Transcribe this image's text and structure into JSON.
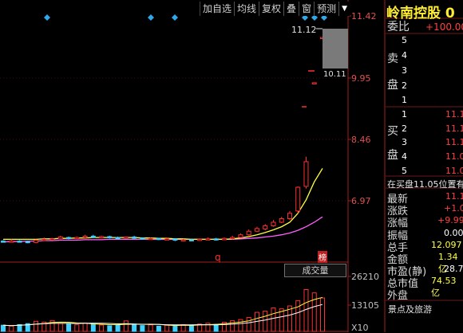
{
  "toolbar": {
    "buttons": [
      "加自选",
      "均线",
      "复权",
      "叠",
      "窗",
      "预测"
    ],
    "dropdown_icon": "caret-down-icon"
  },
  "stock": {
    "name": "岭南控股",
    "code_partial": "0"
  },
  "axis": {
    "price_ticks": [
      "11.42",
      "9.95",
      "8.46",
      "6.97"
    ],
    "volume_ticks": [
      "26210",
      "13105",
      "X10"
    ]
  },
  "annotations": {
    "high_label": "11.12",
    "low_label": "10.11",
    "marker_q": "q",
    "marker_bang": "榜"
  },
  "volume_indicator_label": "成交量",
  "sidebar": {
    "weibi_label": "委比",
    "weibi_value": "+100.00",
    "sell_label": "卖盘",
    "sell_levels": [
      "5",
      "4",
      "3",
      "2",
      "1"
    ],
    "buy_label": "买盘",
    "buy_levels": [
      "1",
      "2",
      "3",
      "4",
      "5"
    ],
    "buy_prices": [
      "11.1",
      "11.1",
      "11.1",
      "11.0",
      "11.0"
    ],
    "note": "在买盘11.05位置有",
    "quotes": [
      {
        "label": "最新",
        "value": "11.1"
      },
      {
        "label": "涨跌",
        "value": "+1.0"
      },
      {
        "label": "涨幅",
        "value": "+9.99"
      },
      {
        "label": "振幅",
        "value": "0.00"
      },
      {
        "label": "总手",
        "value": "12.097"
      },
      {
        "label": "金额",
        "value": "1.34亿"
      },
      {
        "label": "市盈(静)",
        "value": "28.7"
      },
      {
        "label": "总市值",
        "value": "74.53亿"
      },
      {
        "label": "外盘",
        "value": ""
      }
    ],
    "industry": "景点及旅游"
  },
  "colors": {
    "up": "#ff3030",
    "down": "#40d0ff",
    "ma_yellow": "#ffff40",
    "ma_pink": "#ff60ff",
    "axis_red": "#a02020",
    "title": "#ffee30"
  },
  "chart_data": {
    "type": "candlestick",
    "price_range": [
      6.2,
      11.6
    ],
    "candles": [
      {
        "o": 6.58,
        "c": 6.56,
        "h": 6.6,
        "l": 6.55
      },
      {
        "o": 6.56,
        "c": 6.58,
        "h": 6.62,
        "l": 6.55
      },
      {
        "o": 6.58,
        "c": 6.57,
        "h": 6.6,
        "l": 6.55
      },
      {
        "o": 6.57,
        "c": 6.55,
        "h": 6.58,
        "l": 6.53
      },
      {
        "o": 6.55,
        "c": 6.6,
        "h": 6.62,
        "l": 6.53
      },
      {
        "o": 6.6,
        "c": 6.62,
        "h": 6.66,
        "l": 6.58
      },
      {
        "o": 6.62,
        "c": 6.63,
        "h": 6.65,
        "l": 6.6
      },
      {
        "o": 6.63,
        "c": 6.67,
        "h": 6.7,
        "l": 6.62
      },
      {
        "o": 6.66,
        "c": 6.64,
        "h": 6.68,
        "l": 6.62
      },
      {
        "o": 6.64,
        "c": 6.66,
        "h": 6.68,
        "l": 6.62
      },
      {
        "o": 6.66,
        "c": 6.69,
        "h": 6.72,
        "l": 6.64
      },
      {
        "o": 6.69,
        "c": 6.67,
        "h": 6.72,
        "l": 6.65
      },
      {
        "o": 6.67,
        "c": 6.68,
        "h": 6.7,
        "l": 6.66
      },
      {
        "o": 6.68,
        "c": 6.66,
        "h": 6.7,
        "l": 6.64
      },
      {
        "o": 6.66,
        "c": 6.65,
        "h": 6.68,
        "l": 6.63
      },
      {
        "o": 6.65,
        "c": 6.67,
        "h": 6.68,
        "l": 6.63
      },
      {
        "o": 6.67,
        "c": 6.65,
        "h": 6.7,
        "l": 6.63
      },
      {
        "o": 6.65,
        "c": 6.63,
        "h": 6.66,
        "l": 6.61
      },
      {
        "o": 6.63,
        "c": 6.64,
        "h": 6.66,
        "l": 6.62
      },
      {
        "o": 6.64,
        "c": 6.62,
        "h": 6.65,
        "l": 6.6
      },
      {
        "o": 6.62,
        "c": 6.63,
        "h": 6.65,
        "l": 6.6
      },
      {
        "o": 6.63,
        "c": 6.6,
        "h": 6.64,
        "l": 6.58
      },
      {
        "o": 6.6,
        "c": 6.61,
        "h": 6.63,
        "l": 6.58
      },
      {
        "o": 6.61,
        "c": 6.6,
        "h": 6.63,
        "l": 6.58
      },
      {
        "o": 6.6,
        "c": 6.62,
        "h": 6.64,
        "l": 6.59
      },
      {
        "o": 6.62,
        "c": 6.63,
        "h": 6.66,
        "l": 6.6
      },
      {
        "o": 6.63,
        "c": 6.61,
        "h": 6.65,
        "l": 6.59
      },
      {
        "o": 6.61,
        "c": 6.64,
        "h": 6.66,
        "l": 6.6
      },
      {
        "o": 6.64,
        "c": 6.66,
        "h": 6.7,
        "l": 6.62
      },
      {
        "o": 6.66,
        "c": 6.72,
        "h": 6.75,
        "l": 6.65
      },
      {
        "o": 6.72,
        "c": 6.8,
        "h": 6.84,
        "l": 6.7
      },
      {
        "o": 6.8,
        "c": 6.86,
        "h": 6.9,
        "l": 6.78
      },
      {
        "o": 6.85,
        "c": 6.92,
        "h": 6.96,
        "l": 6.82
      },
      {
        "o": 6.92,
        "c": 7.0,
        "h": 7.05,
        "l": 6.9
      },
      {
        "o": 7.0,
        "c": 7.08,
        "h": 7.12,
        "l": 6.98
      },
      {
        "o": 7.08,
        "c": 7.2,
        "h": 7.25,
        "l": 7.05
      },
      {
        "o": 7.25,
        "c": 7.78,
        "h": 7.8,
        "l": 7.2
      },
      {
        "o": 7.8,
        "c": 8.35,
        "h": 8.46,
        "l": 7.75
      },
      {
        "o": 10.11,
        "c": 10.11,
        "h": 10.11,
        "l": 10.11
      },
      {
        "o": 11.12,
        "c": 11.12,
        "h": 11.12,
        "l": 11.12
      }
    ],
    "ma_yellow": [
      6.62,
      6.62,
      6.62,
      6.62,
      6.62,
      6.63,
      6.63,
      6.64,
      6.64,
      6.65,
      6.65,
      6.66,
      6.66,
      6.66,
      6.66,
      6.66,
      6.66,
      6.65,
      6.65,
      6.64,
      6.64,
      6.63,
      6.63,
      6.62,
      6.62,
      6.62,
      6.62,
      6.62,
      6.63,
      6.65,
      6.68,
      6.72,
      6.77,
      6.83,
      6.9,
      7.0,
      7.2,
      7.5,
      7.9,
      8.2
    ],
    "ma_pink": [
      6.56,
      6.57,
      6.57,
      6.58,
      6.58,
      6.59,
      6.59,
      6.6,
      6.6,
      6.6,
      6.61,
      6.61,
      6.61,
      6.62,
      6.62,
      6.62,
      6.62,
      6.62,
      6.62,
      6.62,
      6.62,
      6.62,
      6.62,
      6.62,
      6.62,
      6.62,
      6.62,
      6.62,
      6.62,
      6.63,
      6.64,
      6.65,
      6.67,
      6.69,
      6.72,
      6.76,
      6.82,
      6.9,
      7.0,
      7.12
    ],
    "volume_range": [
      0,
      26210
    ],
    "volumes": [
      3200,
      2800,
      3500,
      4000,
      5200,
      4800,
      5600,
      4100,
      3900,
      3400,
      4300,
      3600,
      3300,
      2900,
      3100,
      5400,
      3800,
      3000,
      3400,
      2700,
      3200,
      2900,
      3500,
      3100,
      3800,
      4200,
      3600,
      4700,
      5500,
      6100,
      7200,
      9800,
      10400,
      12100,
      11600,
      13105,
      15800,
      21500,
      19800,
      17200
    ],
    "volume_up": [
      false,
      true,
      false,
      false,
      true,
      true,
      true,
      true,
      false,
      true,
      true,
      false,
      true,
      false,
      false,
      true,
      false,
      false,
      true,
      false,
      true,
      false,
      true,
      false,
      true,
      true,
      false,
      true,
      true,
      true,
      true,
      true,
      true,
      true,
      true,
      true,
      true,
      true,
      true,
      true
    ]
  }
}
